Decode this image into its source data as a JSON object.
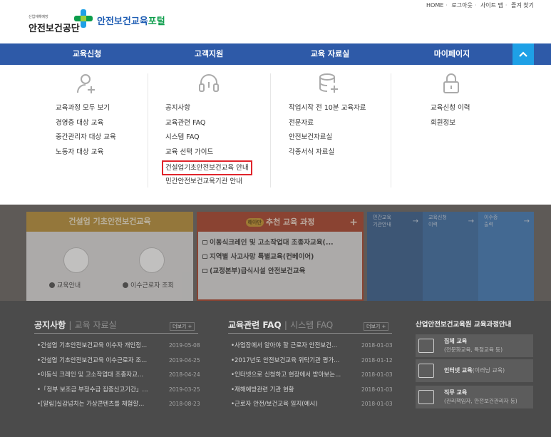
{
  "util_links": [
    "HOME",
    "로그아웃",
    "사이트 맵",
    "즐겨 찾기"
  ],
  "logo": {
    "org_small": "산업재해예방",
    "org": "안전보건공단",
    "portal_part1": "안전보건교육",
    "portal_part2": "포털"
  },
  "nav": {
    "items": [
      "교육신청",
      "고객지원",
      "교육 자료실",
      "마이페이지"
    ],
    "toggle_icon": "chevron-up-icon"
  },
  "mega": {
    "columns": [
      {
        "icon": "user-plus-icon",
        "items": [
          "교육과정 모두 보기",
          "경영층 대상 교육",
          "중간관리자 대상 교육",
          "노동자 대상 교육"
        ]
      },
      {
        "icon": "headset-icon",
        "items": [
          "공지사항",
          "교육관련 FAQ",
          "시스템 FAQ",
          "교육 선택 가이드",
          "건설업기초안전보건교육 안내",
          "민간안전보건교육기관 안내"
        ]
      },
      {
        "icon": "database-plus-icon",
        "items": [
          "작업시작 전 10분 교육자료",
          "전문자료",
          "안전보건자료실",
          "각종서식 자료실"
        ]
      },
      {
        "icon": "lock-icon",
        "items": [
          "교육신청 이력",
          "회원정보"
        ]
      }
    ],
    "highlighted_item": "건설업기초안전보건교육 안내"
  },
  "cards": {
    "construction": {
      "title": "건설업 기초안전보건교육",
      "link1": "교육안내",
      "link2": "이수근로자 조회"
    },
    "recommend": {
      "badge": "해야만",
      "title": "추천 교육 과정",
      "plus": "+",
      "items": [
        "이동식크레인 및 고소작업대 조종자교육(...",
        "지역별 사고사망 특별교육(컨베이어)",
        "(교정본부)급식시설 안전보건교육"
      ]
    },
    "quick": [
      {
        "label_line1": "민간교육",
        "label_line2": "기관안내"
      },
      {
        "label_line1": "교육신청",
        "label_line2": "이력"
      },
      {
        "label_line1": "이수증",
        "label_line2": "출력"
      }
    ]
  },
  "notice": {
    "title": "공지사항",
    "title_dim": "교육 자료실",
    "more": "더보기 +",
    "rows": [
      {
        "text": "건설업 기초안전보건교육 이수자 개인정...",
        "date": "2019-05-08"
      },
      {
        "text": "건설업 기초안전보건교육 이수근로자 조...",
        "date": "2019-04-25"
      },
      {
        "text": "이동식 크레인 및 고소작업대 조종자교...",
        "date": "2018-04-24"
      },
      {
        "text": "「정부 보조금 부정수급 집중신고기간」...",
        "date": "2019-03-25"
      },
      {
        "text": "[알림]실감넘치는 가상콘텐츠를 체험할...",
        "date": "2018-08-23"
      }
    ]
  },
  "faq": {
    "title": "교육관련 FAQ",
    "title_dim": "시스템 FAQ",
    "more": "더보기 +",
    "rows": [
      {
        "text": "사업장에서 알아야 할 근로자 안전보건...",
        "date": "2018-01-03"
      },
      {
        "text": "2017년도 안전보건교육 위탁기관 평가...",
        "date": "2018-01-12"
      },
      {
        "text": "인터넷으로 신청하고 현장에서 받아보는...",
        "date": "2018-01-03"
      },
      {
        "text": "재해예방관련 기관 현황",
        "date": "2018-01-03"
      },
      {
        "text": "근로자 안전/보건교육 일지(예시)",
        "date": "2018-01-03"
      }
    ]
  },
  "guide": {
    "title": "산업안전보건교육원 교육과정안내",
    "rows": [
      {
        "icon": "network-icon",
        "t1": "집체 교육",
        "t2": "(전문화교육, 특정교육 등)"
      },
      {
        "icon": "monitor-icon",
        "t1": "인터넷 교육",
        "t2": "(이러닝 교육)"
      },
      {
        "icon": "book-icon",
        "t1": "직무 교육",
        "t2": "(관리책임자, 안전보건관리자 등)"
      }
    ]
  }
}
